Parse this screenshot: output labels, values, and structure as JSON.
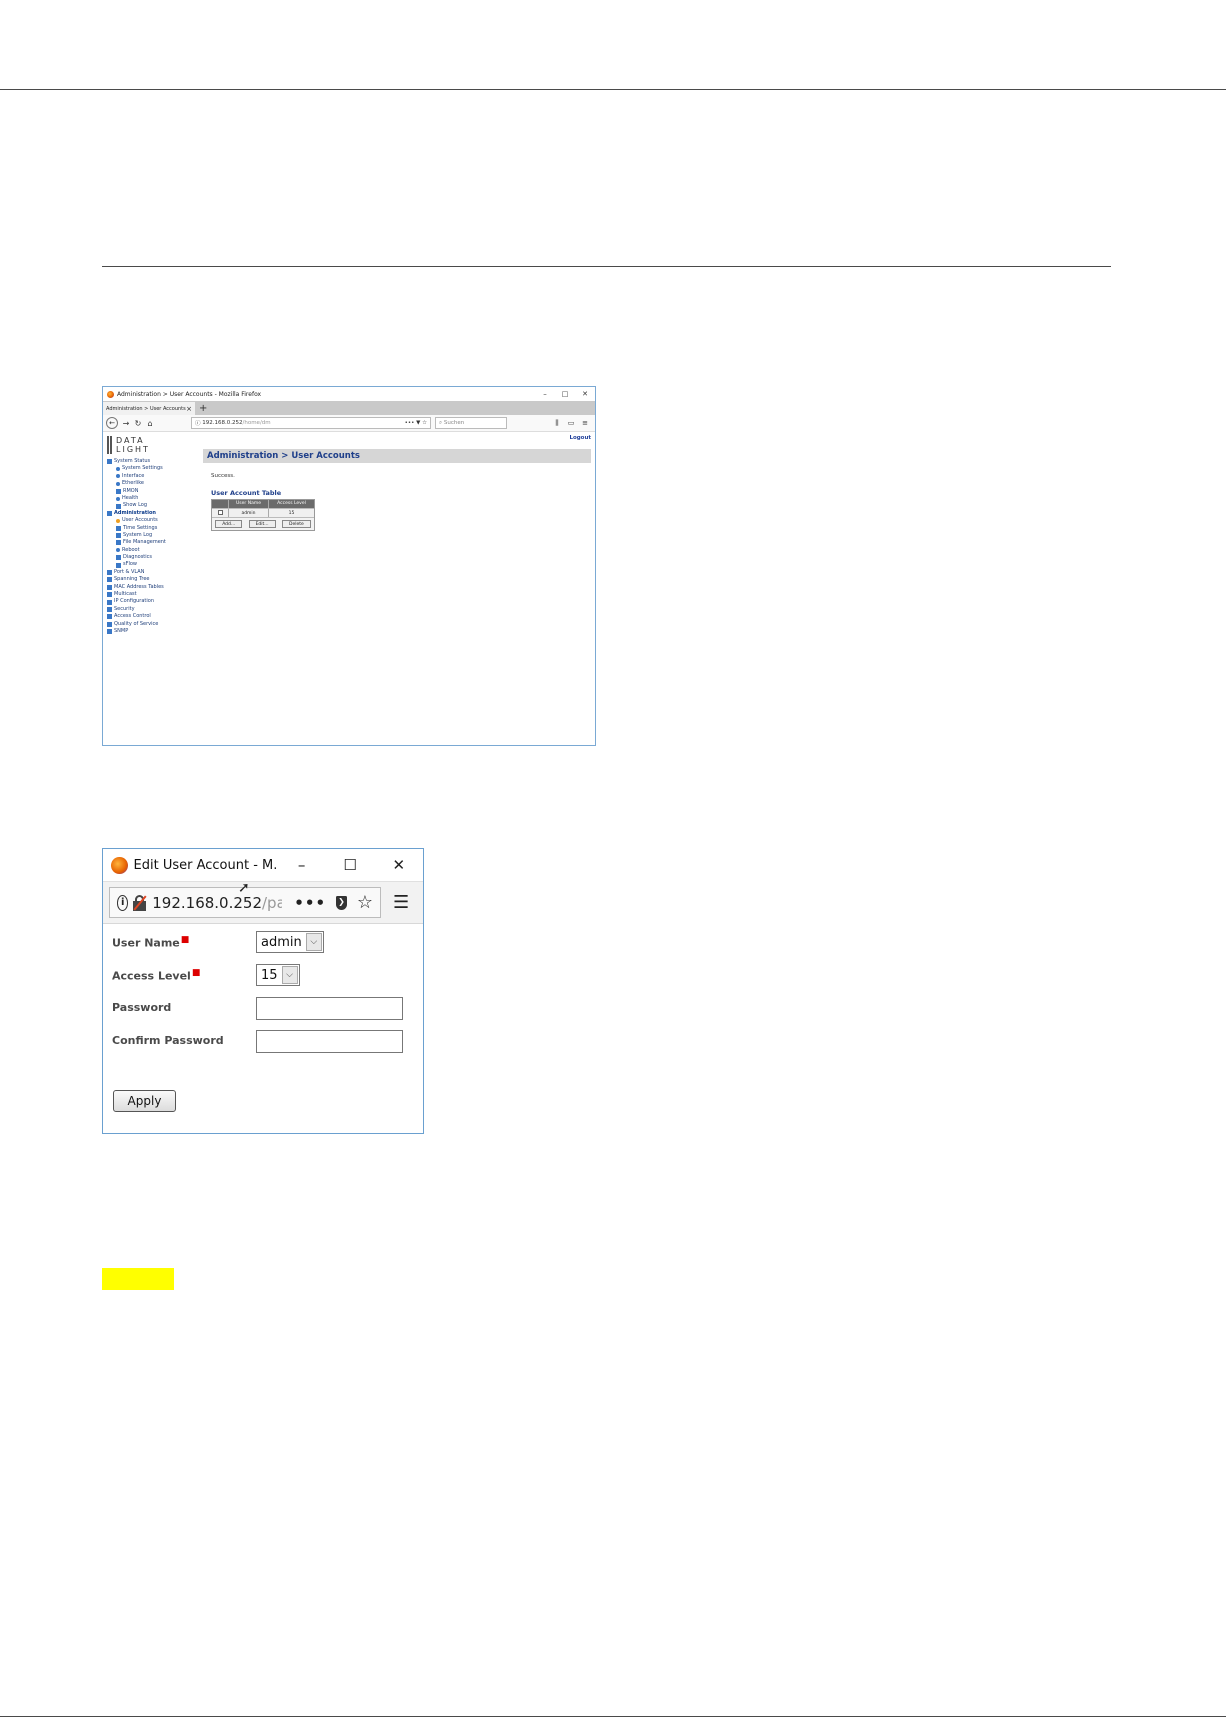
{
  "screenshot1": {
    "window_title": "Administration > User Accounts - Mozilla Firefox",
    "tab_label": "Administration > User Accounts",
    "url_host": "192.168.0.252",
    "url_path": "/home/dm",
    "search_placeholder": "Suchen",
    "logo_line1": "DATA",
    "logo_line2": "LIGHT",
    "logout": "Logout",
    "page_title": "Administration > User Accounts",
    "status": "Success.",
    "table_title": "User Account Table",
    "table_headers": [
      "User Name",
      "Access Level"
    ],
    "table_rows": [
      {
        "user": "admin",
        "level": "15"
      }
    ],
    "buttons": {
      "add": "Add...",
      "edit": "Edit...",
      "delete": "Delete"
    },
    "sidebar": [
      {
        "label": "System Status",
        "level": 1,
        "marker": "square"
      },
      {
        "label": "System Settings",
        "level": 2,
        "marker": "dot"
      },
      {
        "label": "Interface",
        "level": 2,
        "marker": "dot"
      },
      {
        "label": "Etherlike",
        "level": 2,
        "marker": "dot"
      },
      {
        "label": "RMON",
        "level": 2,
        "marker": "square"
      },
      {
        "label": "Health",
        "level": 2,
        "marker": "dot"
      },
      {
        "label": "Show Log",
        "level": 2,
        "marker": "square"
      },
      {
        "label": "Administration",
        "level": 1,
        "marker": "square",
        "active": true
      },
      {
        "label": "User Accounts",
        "level": 2,
        "marker": "dot-orange"
      },
      {
        "label": "Time Settings",
        "level": 2,
        "marker": "square"
      },
      {
        "label": "System Log",
        "level": 2,
        "marker": "square"
      },
      {
        "label": "File Management",
        "level": 2,
        "marker": "square"
      },
      {
        "label": "Reboot",
        "level": 2,
        "marker": "dot"
      },
      {
        "label": "Diagnostics",
        "level": 2,
        "marker": "square"
      },
      {
        "label": "sFlow",
        "level": 2,
        "marker": "square"
      },
      {
        "label": "Port & VLAN",
        "level": 1,
        "marker": "square"
      },
      {
        "label": "Spanning Tree",
        "level": 1,
        "marker": "square"
      },
      {
        "label": "MAC Address Tables",
        "level": 1,
        "marker": "square"
      },
      {
        "label": "Multicast",
        "level": 1,
        "marker": "square"
      },
      {
        "label": "IP Configuration",
        "level": 1,
        "marker": "square"
      },
      {
        "label": "Security",
        "level": 1,
        "marker": "square"
      },
      {
        "label": "Access Control",
        "level": 1,
        "marker": "square"
      },
      {
        "label": "Quality of Service",
        "level": 1,
        "marker": "square"
      },
      {
        "label": "SNMP",
        "level": 1,
        "marker": "square"
      }
    ]
  },
  "screenshot2": {
    "window_title": "Edit User Account - M...",
    "url_host": "192.168.0.252",
    "url_path": "/pas",
    "more_icon": "•••",
    "fields": {
      "user_name_label": "User Name",
      "user_name_value": "admin",
      "access_level_label": "Access Level",
      "access_level_value": "15",
      "password_label": "Password",
      "confirm_password_label": "Confirm Password"
    },
    "apply_label": "Apply"
  },
  "colors": {
    "highlight": "#ffff00",
    "page_bar": "#d6d6d6",
    "nav_blue": "#1f3f8a"
  }
}
